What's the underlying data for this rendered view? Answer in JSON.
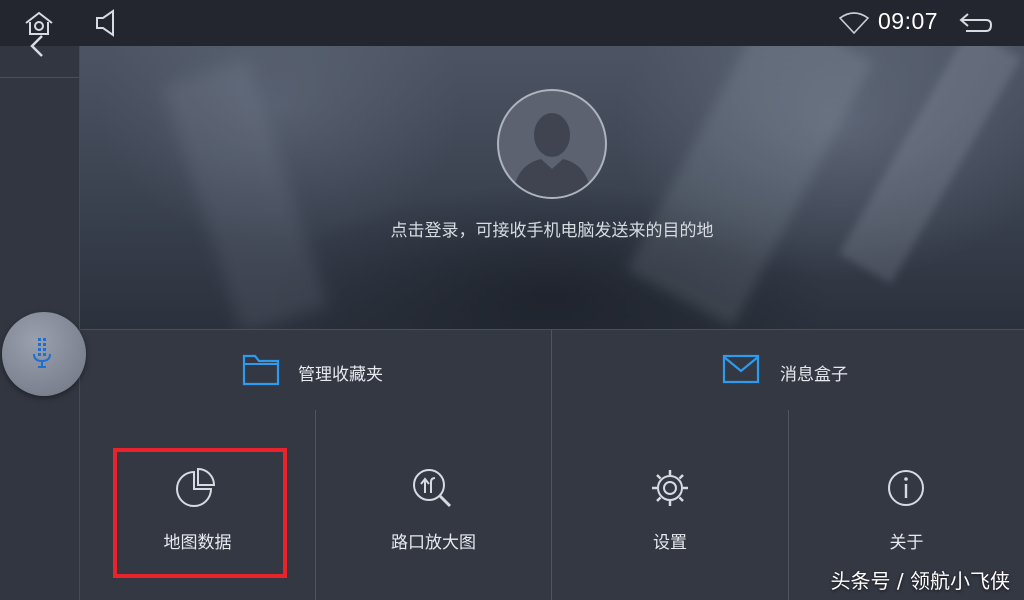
{
  "status_bar": {
    "time": "09:07",
    "icons": [
      "home-icon",
      "volume-icon",
      "wifi-icon",
      "back-icon"
    ]
  },
  "voice": {
    "icon": "microphone-icon"
  },
  "profile": {
    "icon": "user-avatar-icon",
    "login_hint": "点击登录，可接收手机电脑发送来的目的地"
  },
  "menu_row1": [
    {
      "label": "管理收藏夹",
      "icon": "folder-icon"
    },
    {
      "label": "消息盒子",
      "icon": "mail-icon"
    }
  ],
  "menu_row2": [
    {
      "label": "地图数据",
      "icon": "pie-chart-icon"
    },
    {
      "label": "路口放大图",
      "icon": "intersection-zoom-icon"
    },
    {
      "label": "设置",
      "icon": "gear-icon"
    },
    {
      "label": "关于",
      "icon": "info-icon"
    }
  ],
  "colors": {
    "accent_blue": "#2d9cf0",
    "highlight_red": "#e8232b",
    "tile_bg": "#343843"
  },
  "watermark": "头条号 / 领航小飞侠"
}
